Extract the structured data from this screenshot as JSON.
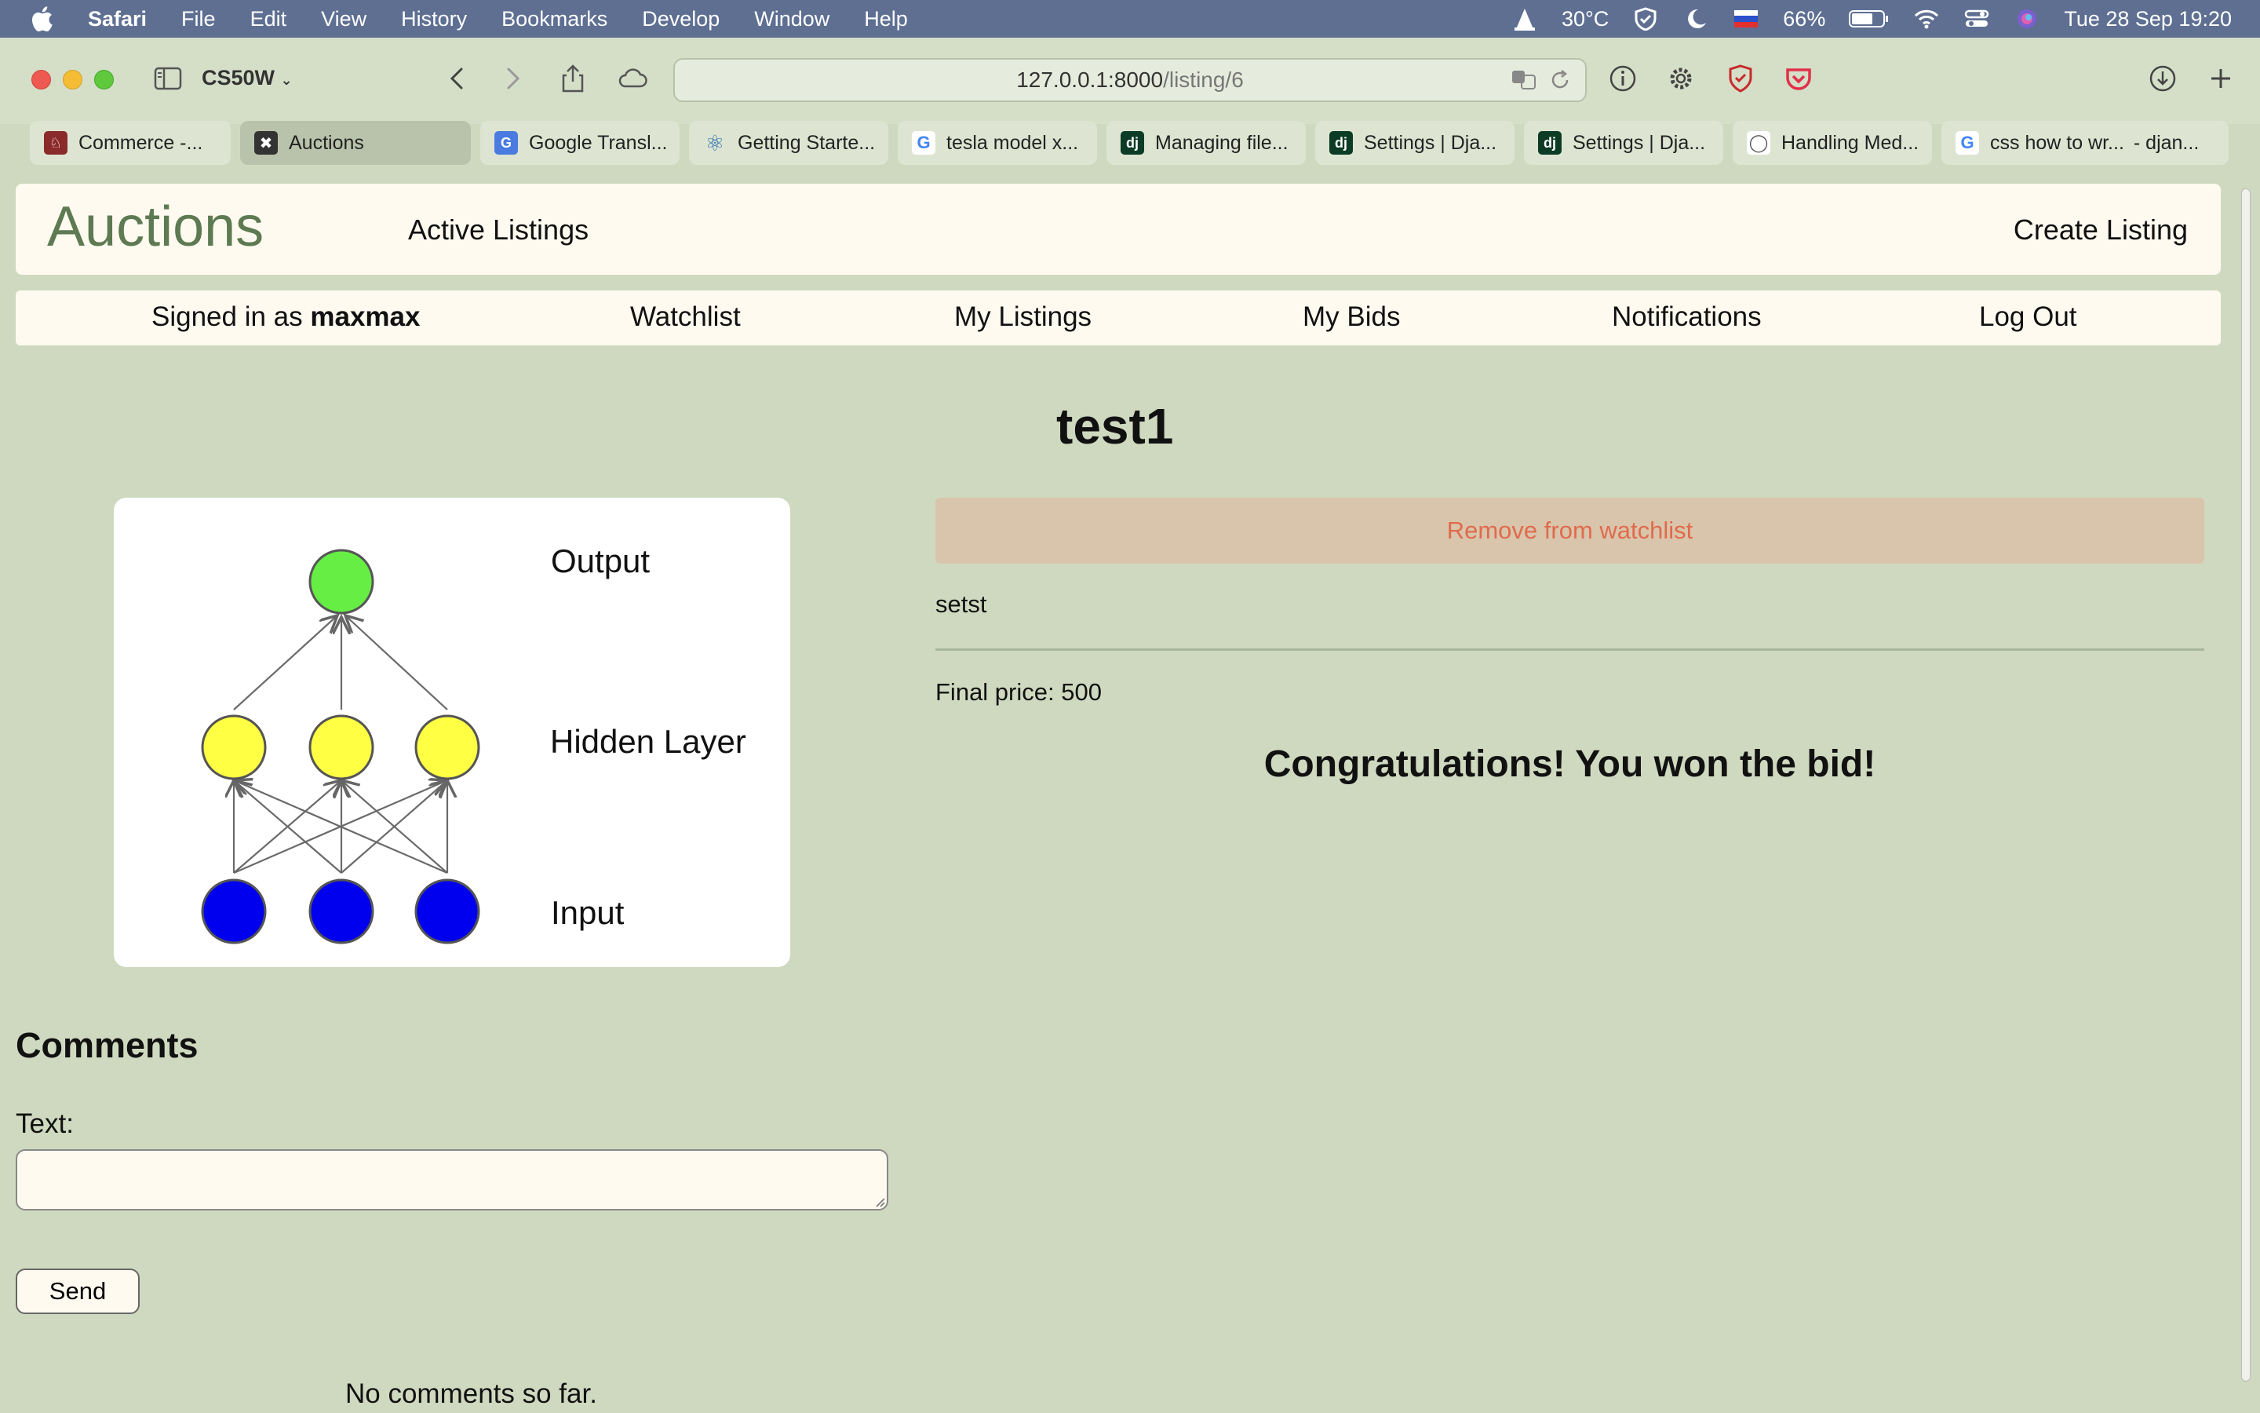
{
  "menubar": {
    "app": "Safari",
    "menus": [
      "File",
      "Edit",
      "View",
      "History",
      "Bookmarks",
      "Develop",
      "Window",
      "Help"
    ],
    "temperature": "30°C",
    "battery": "66%",
    "datetime": "Tue 28 Sep  19:20"
  },
  "toolbar": {
    "profile": "CS50W",
    "url_host": "127.0.0.1:8000",
    "url_path": "/listing/6"
  },
  "tabs": [
    {
      "label": "Commerce -...",
      "icon": "harvard-icon",
      "color": "#8b2a2a"
    },
    {
      "label": "Auctions",
      "icon": "x-icon",
      "color": "#333333",
      "active": true
    },
    {
      "label": "Google Transl...",
      "icon": "google-translate-icon",
      "color": "#4a7be0"
    },
    {
      "label": "Getting Starte...",
      "icon": "react-icon",
      "color": "#2a6fb0"
    },
    {
      "label": "tesla model x...",
      "icon": "google-icon",
      "color": "#ffffff"
    },
    {
      "label": "Managing file...",
      "icon": "django-icon",
      "color": "#0c3c26"
    },
    {
      "label": "Settings | Dja...",
      "icon": "django-icon",
      "color": "#0c3c26"
    },
    {
      "label": "Settings | Dja...",
      "icon": "django-icon",
      "color": "#0c3c26"
    },
    {
      "label": "Handling Med...",
      "icon": "lightbulb-icon",
      "color": "#ffffff"
    },
    {
      "label": "css how to wr...",
      "icon": "google-icon",
      "color": "#ffffff"
    },
    {
      "label": "- djan...",
      "icon": "",
      "color": "#dde5d2"
    }
  ],
  "nav": {
    "brand": "Auctions",
    "active_listings": "Active Listings",
    "create_listing": "Create Listing",
    "signed_in_prefix": "Signed in as ",
    "username": "maxmax",
    "watchlist": "Watchlist",
    "my_listings": "My Listings",
    "my_bids": "My Bids",
    "notifications": "Notifications",
    "log_out": "Log Out"
  },
  "listing": {
    "title": "test1",
    "watch_button": "Remove from watchlist",
    "description": "setst",
    "final_price": "Final price: 500",
    "win_message": "Congratulations! You won the bid!",
    "image_labels": {
      "output": "Output",
      "hidden": "Hidden Layer",
      "input": "Input"
    }
  },
  "comments": {
    "heading": "Comments",
    "text_label": "Text:",
    "input_value": "",
    "send_label": "Send",
    "empty_message": "No comments so far."
  },
  "colors": {
    "page_bg": "#cfd9bf",
    "panel_bg": "#fffaf0",
    "brand": "#5d7a52",
    "watch_btn_bg": "#d9c5ab",
    "watch_btn_text": "#e06b4d",
    "node_output": "#66ee44",
    "node_hidden": "#ffff44",
    "node_input": "#0000ee"
  }
}
